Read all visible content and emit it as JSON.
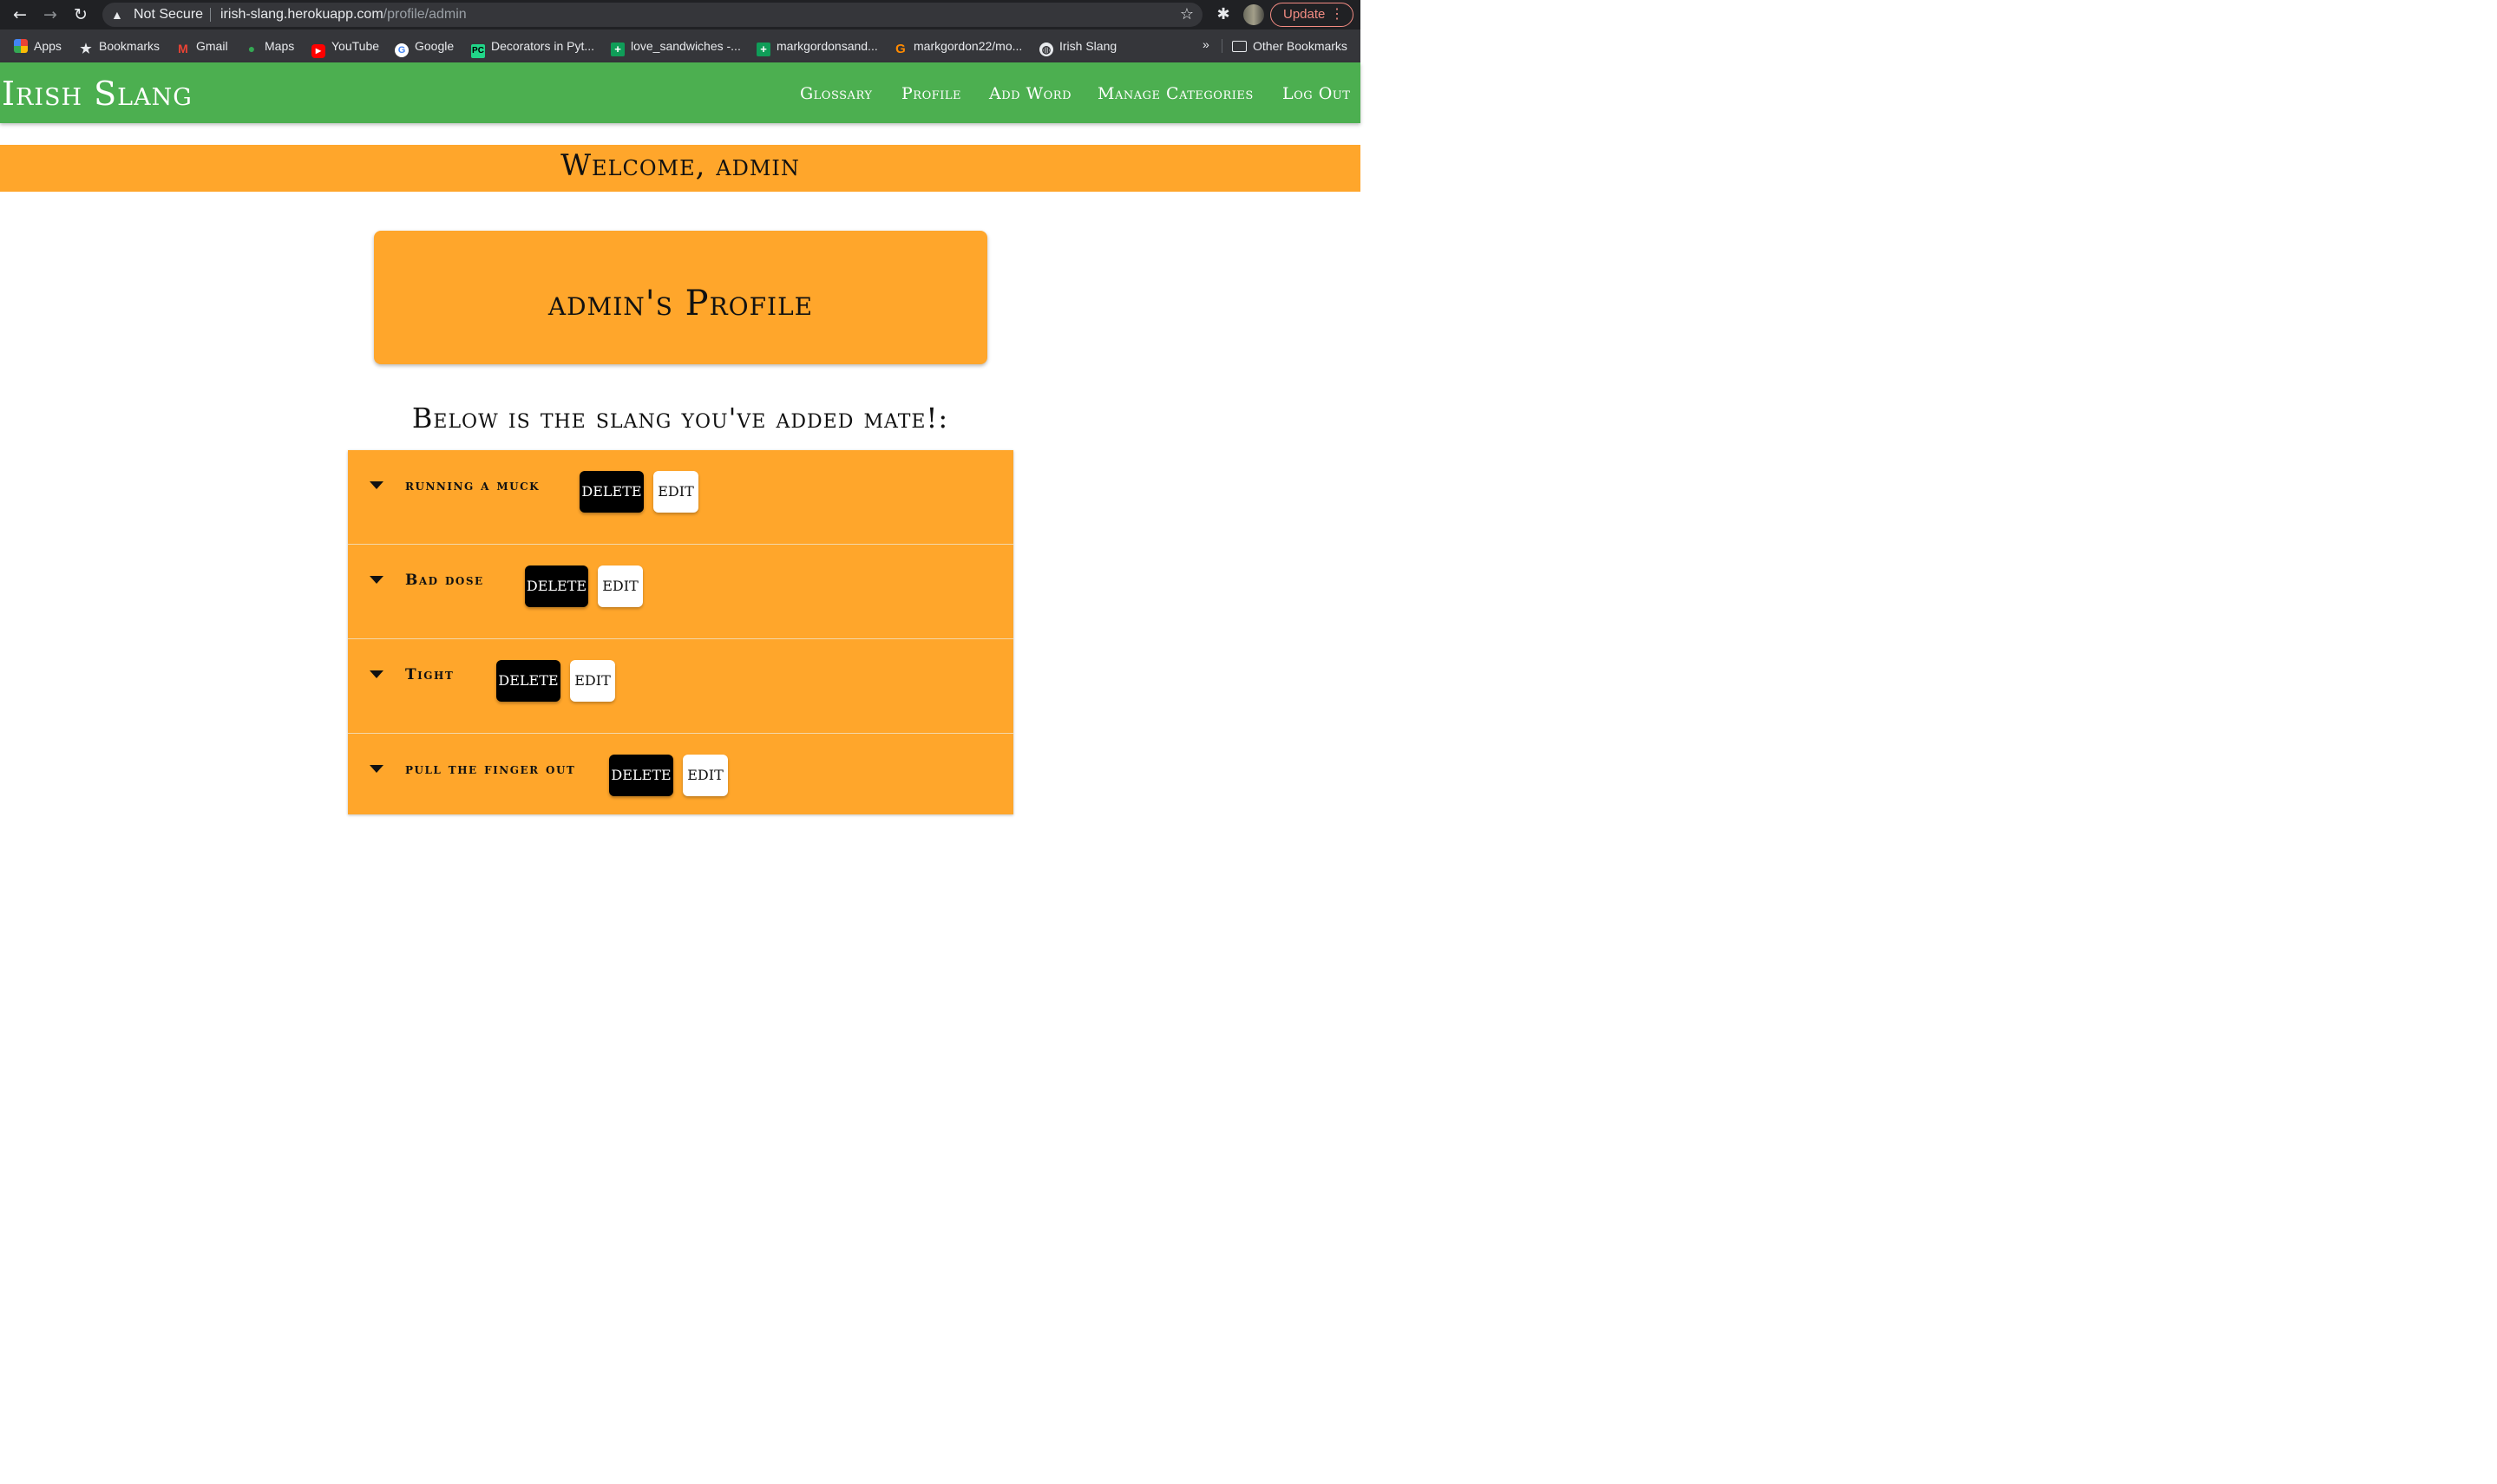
{
  "browser": {
    "security_label": "Not Secure",
    "url_host": "irish-slang.herokuapp.com",
    "url_path": "/profile/admin",
    "update_label": "Update",
    "icons": {
      "back": "back-arrow-icon",
      "forward": "forward-arrow-icon",
      "reload": "reload-icon",
      "warning": "warning-icon",
      "star": "bookmark-star-icon",
      "extensions": "puzzle-icon",
      "menu": "kebab-menu-icon"
    },
    "bookmarks": [
      {
        "label": "Apps",
        "icon": "apps-grid-icon"
      },
      {
        "label": "Bookmarks",
        "icon": "star-icon"
      },
      {
        "label": "Gmail",
        "icon": "gmail-icon"
      },
      {
        "label": "Maps",
        "icon": "maps-pin-icon"
      },
      {
        "label": "YouTube",
        "icon": "youtube-icon"
      },
      {
        "label": "Google",
        "icon": "google-icon"
      },
      {
        "label": "Decorators in Pyt...",
        "icon": "pycharm-icon"
      },
      {
        "label": "love_sandwiches -...",
        "icon": "sheets-icon"
      },
      {
        "label": "markgordonsand...",
        "icon": "sheets-icon"
      },
      {
        "label": "markgordon22/mo...",
        "icon": "gitpod-icon"
      },
      {
        "label": "Irish Slang",
        "icon": "globe-icon"
      }
    ],
    "bookmarks_more": "»",
    "other_bookmarks": "Other Bookmarks"
  },
  "site": {
    "brand": "Irish Slang",
    "nav": [
      "Glossary",
      "Profile",
      "Add Word",
      "Manage Categories",
      "Log Out"
    ],
    "colors": {
      "nav": "#4caf50",
      "accent": "#ffa62b"
    }
  },
  "welcome": "Welcome, admin",
  "profile_title": "admin's Profile",
  "subheading": "Below is the slang you've added mate!:",
  "slang_items": [
    {
      "word": "running a muck",
      "delete_label": "DELETE",
      "edit_label": "EDIT"
    },
    {
      "word": "Bad dose",
      "delete_label": "DELETE",
      "edit_label": "EDIT"
    },
    {
      "word": "Tight",
      "delete_label": "DELETE",
      "edit_label": "EDIT"
    },
    {
      "word": "pull the finger out",
      "delete_label": "DELETE",
      "edit_label": "EDIT"
    }
  ]
}
